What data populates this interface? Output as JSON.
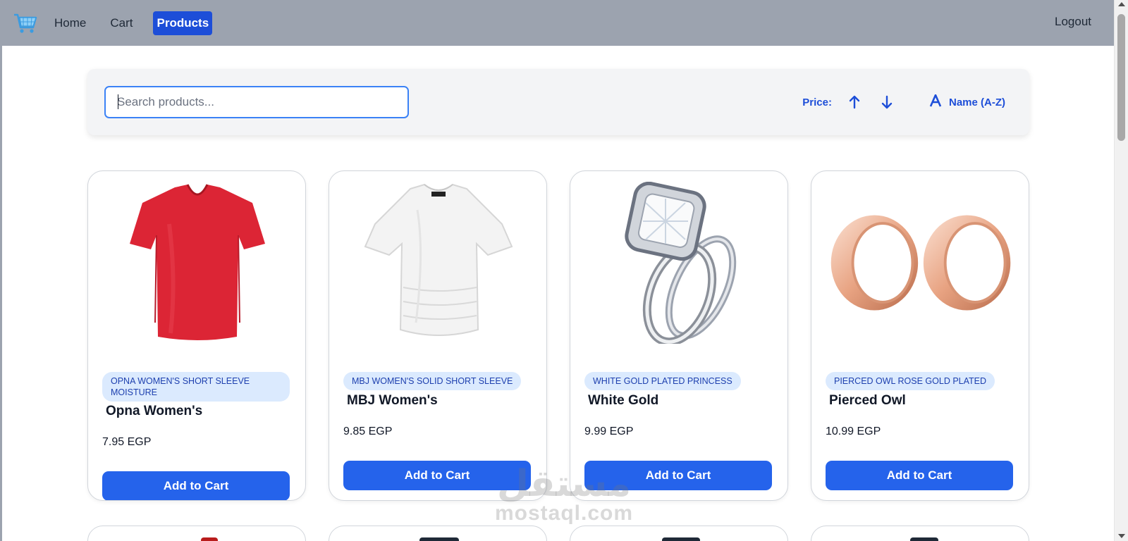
{
  "nav": {
    "logo_icon": "shopping-cart-icon",
    "links": [
      {
        "label": "Home",
        "active": false
      },
      {
        "label": "Cart",
        "active": false
      },
      {
        "label": "Products",
        "active": true
      }
    ],
    "logout_label": "Logout"
  },
  "filters": {
    "search_placeholder": "Search products...",
    "search_value": "",
    "price_label": "Price:",
    "price_asc_icon": "arrow-up-icon",
    "price_desc_icon": "arrow-down-icon",
    "name_sort_icon": "font-letter-a-icon",
    "name_sort_label": "Name (A-Z)"
  },
  "products": [
    {
      "category": "OPNA WOMEN'S SHORT SLEEVE MOISTURE",
      "name": "Opna Women's",
      "price": "7.95 EGP",
      "button": "Add to Cart",
      "image": "red-v-neck-tshirt"
    },
    {
      "category": "MBJ WOMEN'S SOLID SHORT SLEEVE",
      "name": "MBJ Women's",
      "price": "9.85 EGP",
      "button": "Add to Cart",
      "image": "white-short-sleeve-top"
    },
    {
      "category": "WHITE GOLD PLATED PRINCESS",
      "name": "White Gold",
      "price": "9.99 EGP",
      "button": "Add to Cart",
      "image": "diamond-ring-set"
    },
    {
      "category": "PIERCED OWL ROSE GOLD PLATED",
      "name": "Pierced Owl",
      "price": "10.99 EGP",
      "button": "Add to Cart",
      "image": "rose-gold-tunnel-plugs"
    }
  ],
  "watermark": {
    "arabic": "مستقل",
    "latin": "mostaql.com"
  },
  "colors": {
    "nav_bg": "#9ca3af",
    "accent": "#2563eb",
    "active_nav": "#1d4ed8",
    "badge_bg": "#dbeafe",
    "badge_text": "#1e40af"
  }
}
